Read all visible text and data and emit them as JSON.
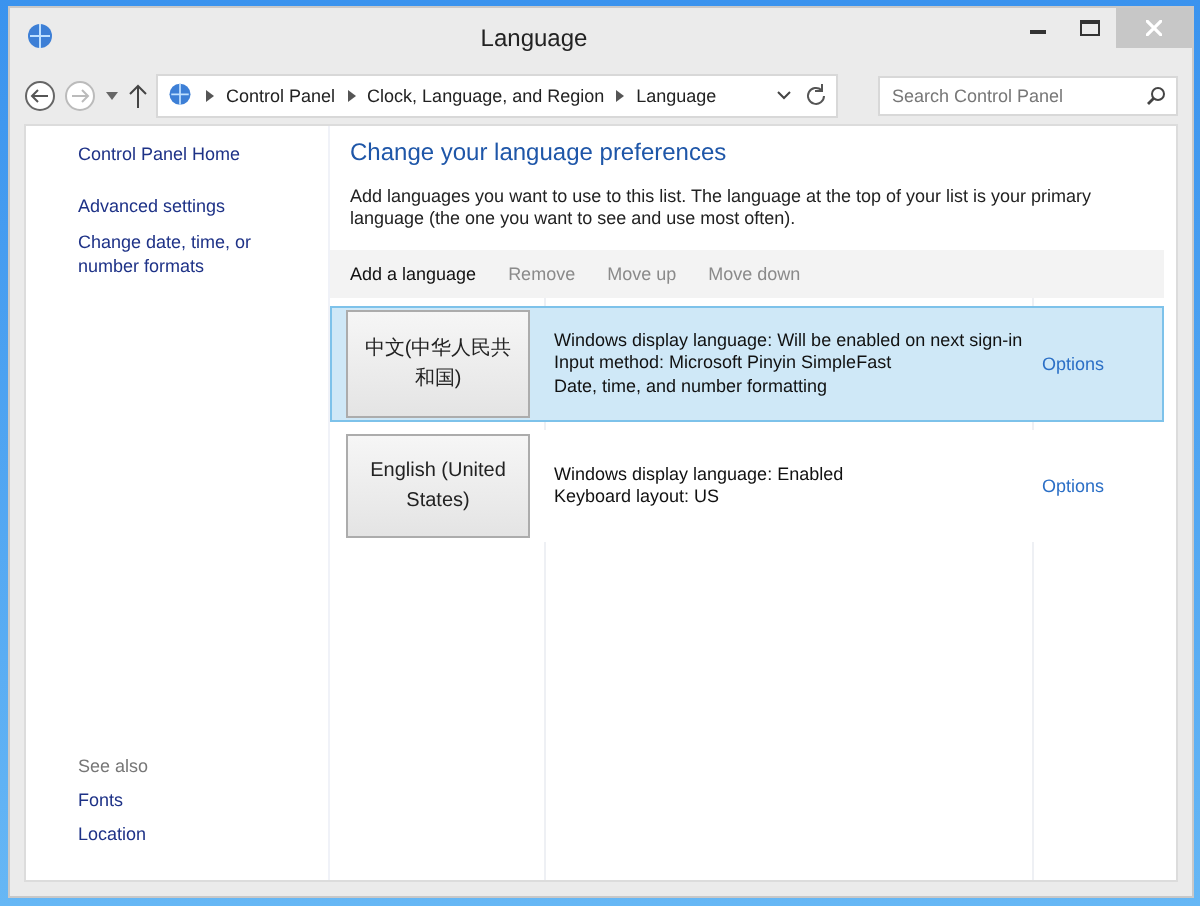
{
  "window": {
    "title": "Language"
  },
  "address_bar": {
    "breadcrumbs": [
      "Control Panel",
      "Clock, Language, and Region",
      "Language"
    ]
  },
  "search": {
    "placeholder": "Search Control Panel"
  },
  "sidebar": {
    "links": [
      "Control Panel Home",
      "Advanced settings",
      "Change date, time, or number formats"
    ],
    "see_also_heading": "See also",
    "see_also": [
      "Fonts",
      "Location"
    ]
  },
  "heading": "Change your language preferences",
  "description": "Add languages you want to use to this list. The language at the top of your list is your primary language (the one you want to see and use most often).",
  "toolbar": [
    {
      "label": "Add a language",
      "disabled": false
    },
    {
      "label": "Remove",
      "disabled": true
    },
    {
      "label": "Move up",
      "disabled": true
    },
    {
      "label": "Move down",
      "disabled": true
    }
  ],
  "languages": [
    {
      "name": "中文(中华人民共和国)",
      "details": [
        "Windows display language: Will be enabled on next sign-in",
        "Input method: Microsoft Pinyin SimpleFast",
        "Date, time, and number formatting"
      ],
      "options": "Options",
      "selected": true
    },
    {
      "name": "English (United States)",
      "details": [
        "Windows display language: Enabled",
        "Keyboard layout: US"
      ],
      "options": "Options",
      "selected": false
    }
  ]
}
